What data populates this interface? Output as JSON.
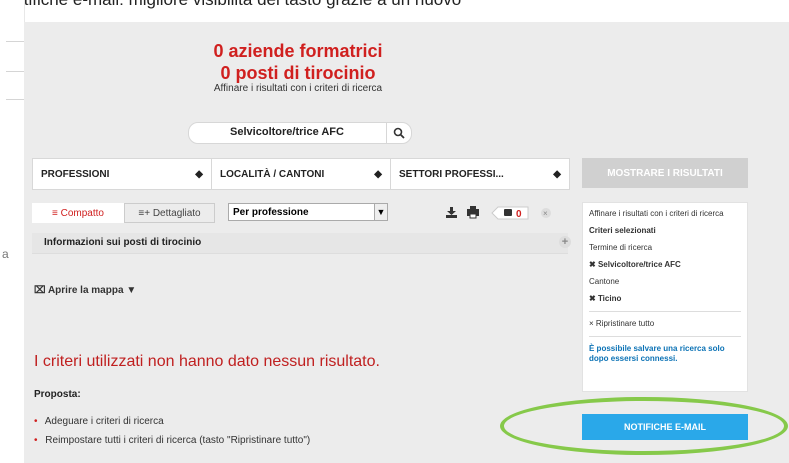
{
  "top_banner": "Notifiche e-mail: migliore visibilità del tasto grazie a un nuovo",
  "headline": {
    "companies": "0 aziende formatrici",
    "positions": "0 posti di tirocinio",
    "subtitle": "Affinare i risultati con i criteri di ricerca"
  },
  "search": {
    "value": "Selvicoltore/trice AFC"
  },
  "filters": [
    "PROFESSIONI",
    "LOCALITÀ / CANTONI",
    "SETTORI PROFESSI..."
  ],
  "view": {
    "compact": "≡ Compatto",
    "detailed": "≡+ Dettagliato",
    "sort": "Per professione",
    "count": "0"
  },
  "info_row": "Informazioni sui posti di tirocinio",
  "map_link": "Aprire la mappa",
  "no_result": "I criteri utilizzati non hanno dato nessun risultato.",
  "proposal_title": "Proposta:",
  "proposals": [
    "Adeguare i criteri di ricerca",
    "Reimpostare tutti i criteri di ricerca (tasto \"Ripristinare tutto\")"
  ],
  "sidebar": {
    "show_results": "MOSTRARE I RISULTATI",
    "refine_text": "Affinare i risultati con i criteri di ricerca",
    "selected_criteria": "Criteri selezionati",
    "search_term_label": "Termine di ricerca",
    "search_term_value": "Selvicoltore/trice AFC",
    "canton_label": "Cantone",
    "canton_value": "Ticino",
    "reset_all": "Ripristinare tutto",
    "save_hint": "È possibile salvare una ricerca solo dopo essersi connessi.",
    "notify_button": "NOTIFICHE E-MAIL"
  },
  "left_strip_glyph": "a",
  "colors": {
    "accent_red": "#d0201f",
    "accent_blue": "#2aa8e9",
    "highlight_green": "#86c94a"
  }
}
